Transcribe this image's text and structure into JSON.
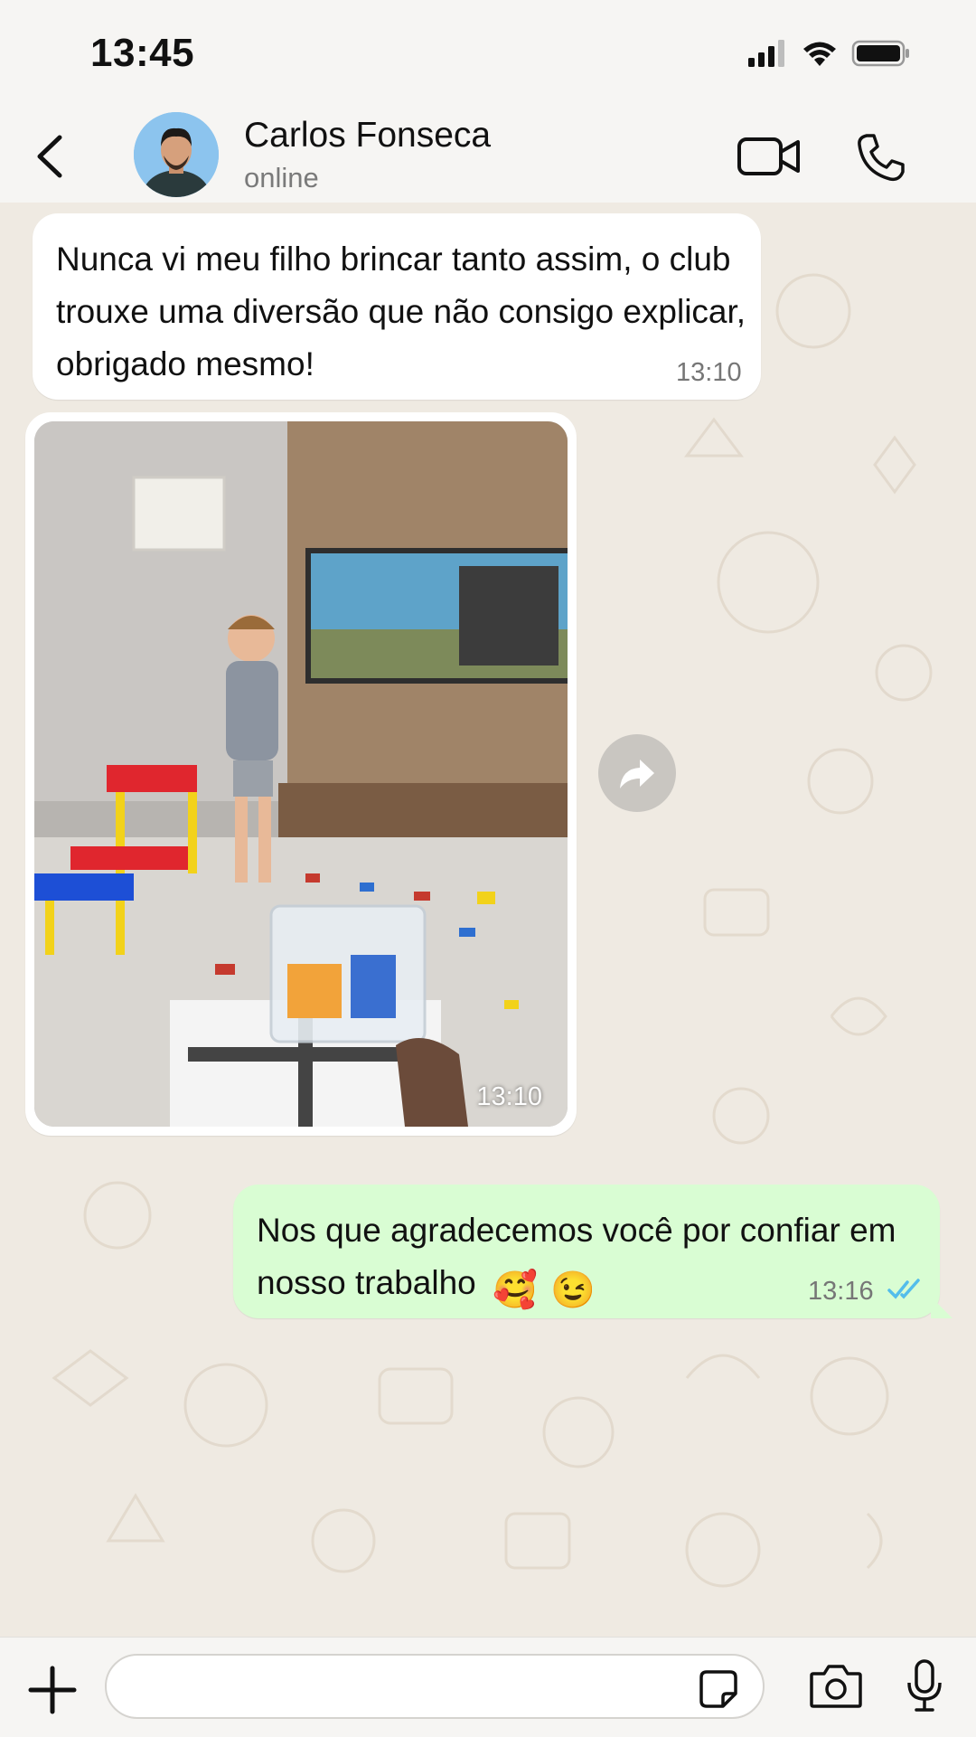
{
  "status_bar": {
    "time": "13:45",
    "icons": [
      "signal-icon",
      "wifi-icon",
      "battery-icon"
    ]
  },
  "header": {
    "back_icon": "chevron-left-icon",
    "contact_name": "Carlos Fonseca",
    "contact_status": "online",
    "actions": [
      "video-call-icon",
      "phone-icon"
    ]
  },
  "messages": [
    {
      "direction": "incoming",
      "type": "text",
      "text": "Nunca vi meu filho brincar tanto assim, o club trouxe uma diversão que não consigo explicar, obrigado mesmo!",
      "time": "13:10"
    },
    {
      "direction": "incoming",
      "type": "image",
      "time": "13:10"
    },
    {
      "direction": "outgoing",
      "type": "text",
      "text": "Nos que agradecemos você por confiar em nosso trabalho",
      "emojis": [
        "🥰",
        "😉"
      ],
      "time": "13:16",
      "read": true
    }
  ],
  "composer": {
    "input_value": "",
    "placeholder": "",
    "icons": [
      "plus-icon",
      "sticker-icon",
      "camera-icon",
      "mic-icon"
    ]
  },
  "colors": {
    "header_bg": "#f6f5f3",
    "chat_bg": "#efeae2",
    "incoming_bubble": "#ffffff",
    "outgoing_bubble": "#d9fdd3",
    "read_ticks": "#53bdeb"
  }
}
